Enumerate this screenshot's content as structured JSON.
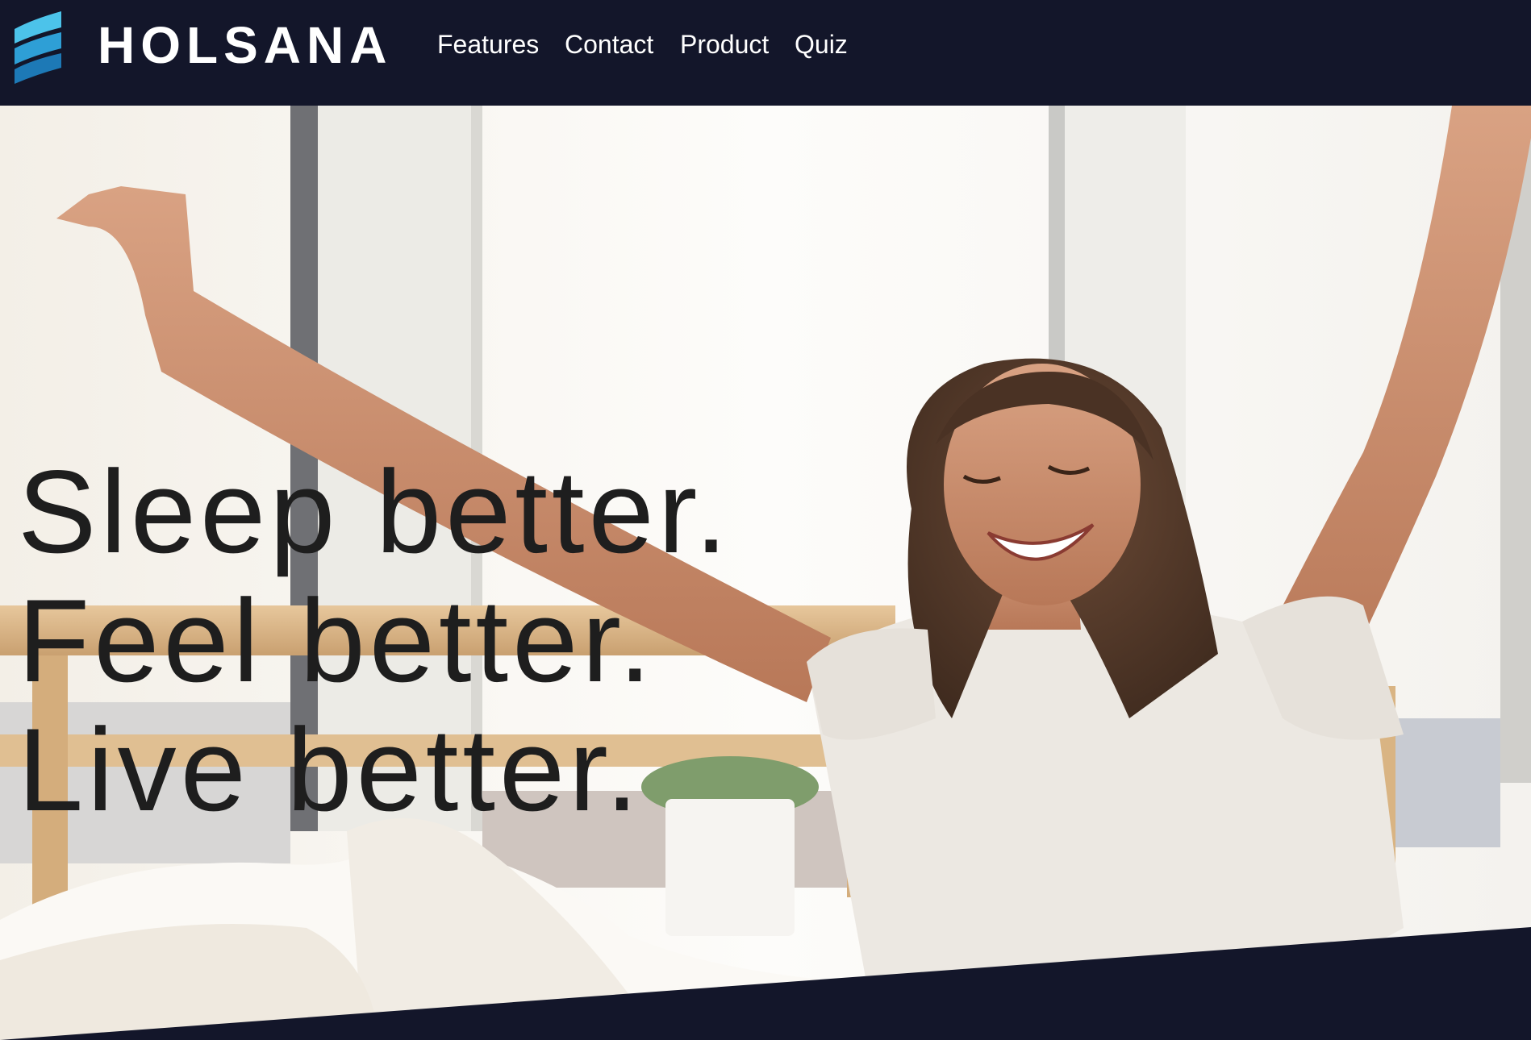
{
  "brand": {
    "name": "HOLSANA",
    "logo_icon": "wave-stripes-icon"
  },
  "nav": {
    "items": [
      {
        "label": "Features"
      },
      {
        "label": "Contact"
      },
      {
        "label": "Product"
      },
      {
        "label": "Quiz"
      }
    ]
  },
  "hero": {
    "lines": [
      "Sleep better.",
      "Feel better.",
      "Live better."
    ],
    "image": "woman-stretching-in-bed-photo"
  },
  "colors": {
    "navbar_bg": "#13162a",
    "logo_blue_light": "#4cc3ea",
    "logo_blue_dark": "#1d79b6",
    "headline": "#1e1e1e",
    "nav_text": "#ffffff"
  }
}
